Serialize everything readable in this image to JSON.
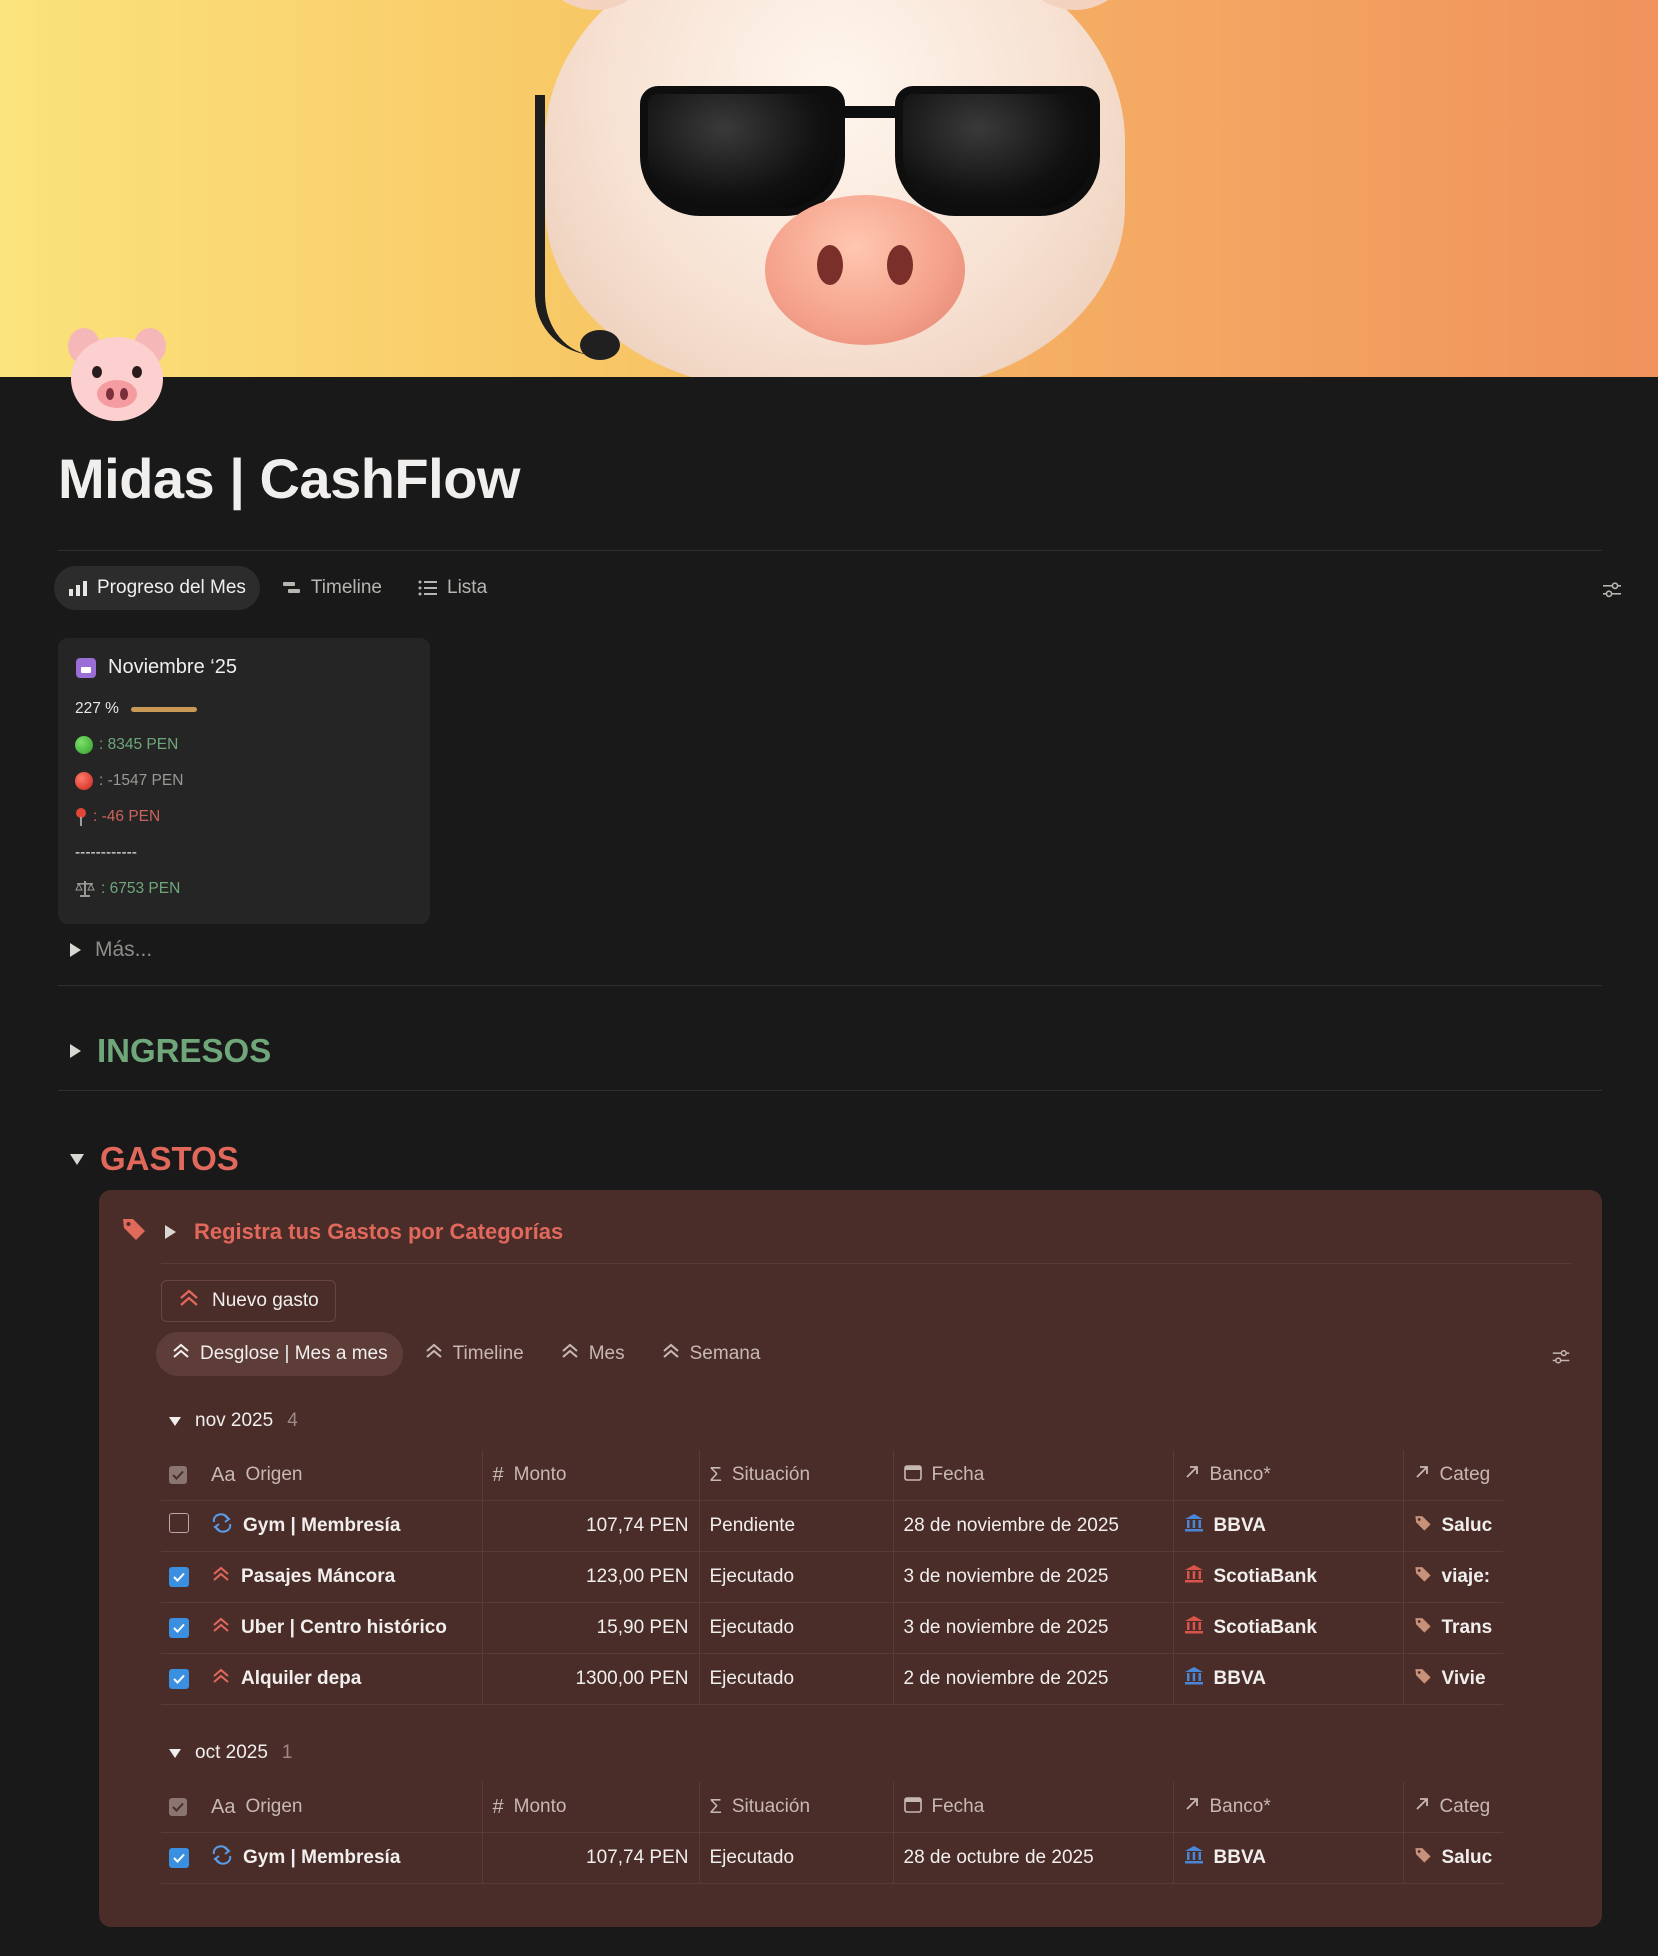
{
  "page": {
    "title": "Midas | CashFlow",
    "icon": "pig-face-icon"
  },
  "tabs": [
    {
      "label": "Progreso del Mes",
      "icon": "chart-icon",
      "active": true
    },
    {
      "label": "Timeline",
      "icon": "timeline-icon",
      "active": false
    },
    {
      "label": "Lista",
      "icon": "list-icon",
      "active": false
    }
  ],
  "progress_card": {
    "title": "Noviembre ‘25",
    "percent_text": "227 %",
    "percent_value": 227,
    "income": ": 8345 PEN",
    "expenses": ": -1547 PEN",
    "pending": ": -46 PEN",
    "divider": "------------",
    "balance": ": 6753 PEN"
  },
  "more_toggle": "Más...",
  "sections": {
    "ingresos": "INGRESOS",
    "gastos": "GASTOS"
  },
  "gastos": {
    "callout": "Registra tus Gastos por Categorías",
    "new_button": "Nuevo gasto",
    "views": [
      {
        "label": "Desglose | Mes a mes",
        "active": true
      },
      {
        "label": "Timeline",
        "active": false
      },
      {
        "label": "Mes",
        "active": false
      },
      {
        "label": "Semana",
        "active": false
      }
    ],
    "columns": {
      "origen": "Origen",
      "monto": "Monto",
      "situacion": "Situación",
      "fecha": "Fecha",
      "banco": "Banco*",
      "categoria": "Categ"
    },
    "groups": [
      {
        "label": "nov 2025",
        "count": "4",
        "rows": [
          {
            "checked": false,
            "icon": "repeat-icon",
            "origen": "Gym | Membresía",
            "monto": "107,74 PEN",
            "situacion": "Pendiente",
            "fecha": "28 de noviembre de 2025",
            "banco": "BBVA",
            "bank_color": "#4a86d8",
            "categoria": "Saluc"
          },
          {
            "checked": true,
            "icon": "double-chevron-up-icon",
            "origen": "Pasajes Máncora",
            "monto": "123,00 PEN",
            "situacion": "Ejecutado",
            "fecha": "3 de noviembre de 2025",
            "banco": "ScotiaBank",
            "bank_color": "#d9554b",
            "categoria": "viaje:"
          },
          {
            "checked": true,
            "icon": "double-chevron-up-icon",
            "origen": "Uber | Centro histórico",
            "monto": "15,90 PEN",
            "situacion": "Ejecutado",
            "fecha": "3 de noviembre de 2025",
            "banco": "ScotiaBank",
            "bank_color": "#d9554b",
            "categoria": "Trans"
          },
          {
            "checked": true,
            "icon": "double-chevron-up-icon",
            "origen": "Alquiler depa",
            "monto": "1300,00 PEN",
            "situacion": "Ejecutado",
            "fecha": "2 de noviembre de 2025",
            "banco": "BBVA",
            "bank_color": "#4a86d8",
            "categoria": "Vivie"
          }
        ]
      },
      {
        "label": "oct 2025",
        "count": "1",
        "rows": [
          {
            "checked": true,
            "icon": "repeat-icon",
            "origen": "Gym | Membresía",
            "monto": "107,74 PEN",
            "situacion": "Ejecutado",
            "fecha": "28 de octubre de 2025",
            "banco": "BBVA",
            "bank_color": "#4a86d8",
            "categoria": "Saluc"
          }
        ]
      }
    ]
  },
  "colors": {
    "background": "#191919",
    "gastos_panel": "#4a2c29",
    "ingresos": "#6fa77b",
    "gastos": "#e0695c",
    "link_blue": "#5a9ce8"
  }
}
